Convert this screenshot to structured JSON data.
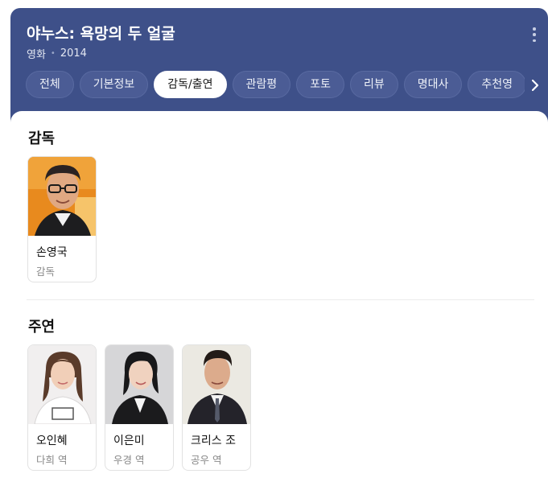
{
  "header": {
    "title": "야누스: 욕망의 두 얼굴",
    "category": "영화",
    "year": "2014",
    "more_icon": "more-vertical-icon"
  },
  "tabs": [
    {
      "label": "전체",
      "active": false
    },
    {
      "label": "기본정보",
      "active": false
    },
    {
      "label": "감독/출연",
      "active": true
    },
    {
      "label": "관람평",
      "active": false
    },
    {
      "label": "포토",
      "active": false
    },
    {
      "label": "리뷰",
      "active": false
    },
    {
      "label": "명대사",
      "active": false
    },
    {
      "label": "추천영",
      "active": false
    }
  ],
  "tabs_next_icon": "chevron-right-icon",
  "director_section": {
    "title": "감독",
    "people": [
      {
        "name": "손영국",
        "role": "감독"
      }
    ]
  },
  "cast_section": {
    "title": "주연",
    "people": [
      {
        "name": "오인혜",
        "role": "다희 역"
      },
      {
        "name": "이은미",
        "role": "우경 역"
      },
      {
        "name": "크리스 조",
        "role": "공우 역"
      }
    ]
  },
  "colors": {
    "header_bg": "#3e5089",
    "tab_bg": "#4b5c95",
    "tab_active_bg": "#ffffff"
  }
}
